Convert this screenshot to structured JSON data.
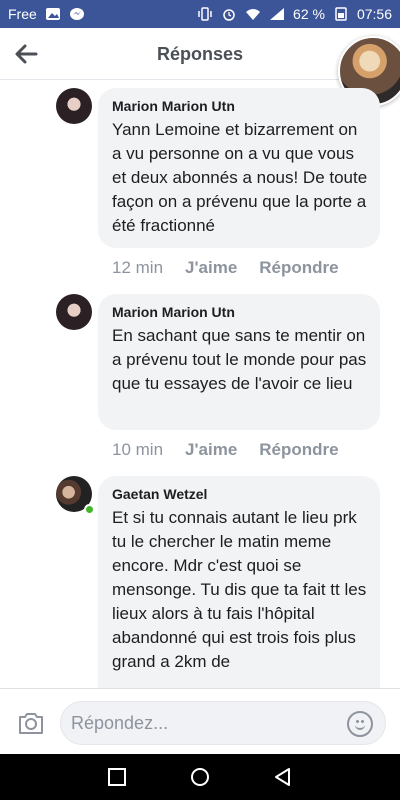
{
  "status": {
    "carrier": "Free",
    "battery": "62 %",
    "time": "07:56"
  },
  "header": {
    "title": "Réponses"
  },
  "comments": [
    {
      "author": "Marion Marion Utn",
      "text": "Yann Lemoine et bizarrement on a vu personne on a vu que vous et deux abonnés a nous! De toute façon on a prévenu que la porte a été fractionné",
      "time": "12 min",
      "like": "J'aime",
      "reply": "Répondre"
    },
    {
      "author": "Marion Marion Utn",
      "text": "En sachant que sans te mentir on a prévenu tout le monde pour pas que tu essayes de l'avoir ce lieu",
      "time": "10 min",
      "like": "J'aime",
      "reply": "Répondre"
    },
    {
      "author": "Gaetan Wetzel",
      "text": "Et si tu connais autant le lieu prk tu le chercher le matin meme encore. Mdr c'est quoi se mensonge. Tu dis que ta fait tt les lieux alors à tu fais l'hôpital abandonné qui est trois fois plus grand a 2km de"
    }
  ],
  "composer": {
    "placeholder": "Répondez..."
  },
  "colors": {
    "status_bar": "#3b5598",
    "bubble": "#f2f3f5",
    "meta": "#8d949e",
    "online": "#42b72a"
  },
  "icons": [
    "image-icon",
    "messenger-icon",
    "vibrate-icon",
    "alarm-icon",
    "wifi-icon",
    "signal-icon",
    "battery-icon",
    "back-arrow-icon",
    "camera-icon",
    "emoji-icon",
    "square-icon",
    "circle-icon",
    "triangle-back-icon"
  ]
}
